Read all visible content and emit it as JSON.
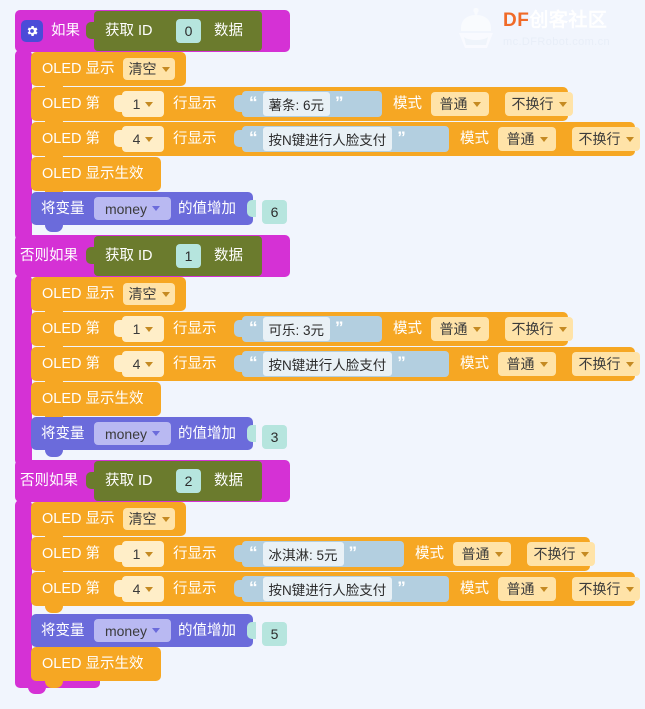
{
  "app": {
    "background_color": "#f1f5fd",
    "logo": {
      "brand_df": "DF",
      "brand_cn": "创客社区",
      "url": "mc.DFRobot.com.cn"
    }
  },
  "colors": {
    "control_block": "#d531d5",
    "sensor_block": "#6b7b2d",
    "oled_block": "#f6a723",
    "variable_block": "#6b6bdb",
    "number_field": "#b6e5de",
    "string_field": "#b3cfe0",
    "dropdown_field": "#ffe3a8",
    "gear_badge": "#4b4bd8"
  },
  "program": {
    "gear_icon": "gear-icon",
    "branches": [
      {
        "keyword": "如果",
        "condition": {
          "prefix": "获取 ID",
          "value": "0",
          "suffix": "数据"
        },
        "statements": [
          {
            "type": "oled_display",
            "label": "OLED 显示",
            "mode": "清空"
          },
          {
            "type": "oled_line",
            "label_a": "OLED 第",
            "line": "1",
            "label_b": "行显示",
            "text": "薯条: 6元",
            "label_c": "模式",
            "mode": "普通",
            "wrap": "不换行"
          },
          {
            "type": "oled_line",
            "label_a": "OLED 第",
            "line": "4",
            "label_b": "行显示",
            "text": "按N键进行人脸支付",
            "label_c": "模式",
            "mode": "普通",
            "wrap": "不换行"
          },
          {
            "type": "oled_effect",
            "label": "OLED 显示生效"
          },
          {
            "type": "variable_change",
            "label_a": "将变量",
            "variable": "money",
            "label_b": "的值增加",
            "value": "6"
          }
        ]
      },
      {
        "keyword": "否则如果",
        "condition": {
          "prefix": "获取 ID",
          "value": "1",
          "suffix": "数据"
        },
        "statements": [
          {
            "type": "oled_display",
            "label": "OLED 显示",
            "mode": "清空"
          },
          {
            "type": "oled_line",
            "label_a": "OLED 第",
            "line": "1",
            "label_b": "行显示",
            "text": "可乐: 3元",
            "label_c": "模式",
            "mode": "普通",
            "wrap": "不换行"
          },
          {
            "type": "oled_line",
            "label_a": "OLED 第",
            "line": "4",
            "label_b": "行显示",
            "text": "按N键进行人脸支付",
            "label_c": "模式",
            "mode": "普通",
            "wrap": "不换行"
          },
          {
            "type": "oled_effect",
            "label": "OLED 显示生效"
          },
          {
            "type": "variable_change",
            "label_a": "将变量",
            "variable": "money",
            "label_b": "的值增加",
            "value": "3"
          }
        ]
      },
      {
        "keyword": "否则如果",
        "condition": {
          "prefix": "获取 ID",
          "value": "2",
          "suffix": "数据"
        },
        "statements": [
          {
            "type": "oled_display",
            "label": "OLED 显示",
            "mode": "清空"
          },
          {
            "type": "oled_line",
            "label_a": "OLED 第",
            "line": "1",
            "label_b": "行显示",
            "text": "冰淇淋: 5元",
            "label_c": "模式",
            "mode": "普通",
            "wrap": "不换行"
          },
          {
            "type": "oled_line",
            "label_a": "OLED 第",
            "line": "4",
            "label_b": "行显示",
            "text": "按N键进行人脸支付",
            "label_c": "模式",
            "mode": "普通",
            "wrap": "不换行"
          },
          {
            "type": "variable_change",
            "label_a": "将变量",
            "variable": "money",
            "label_b": "的值增加",
            "value": "5"
          },
          {
            "type": "oled_effect",
            "label": "OLED 显示生效"
          }
        ]
      }
    ]
  }
}
